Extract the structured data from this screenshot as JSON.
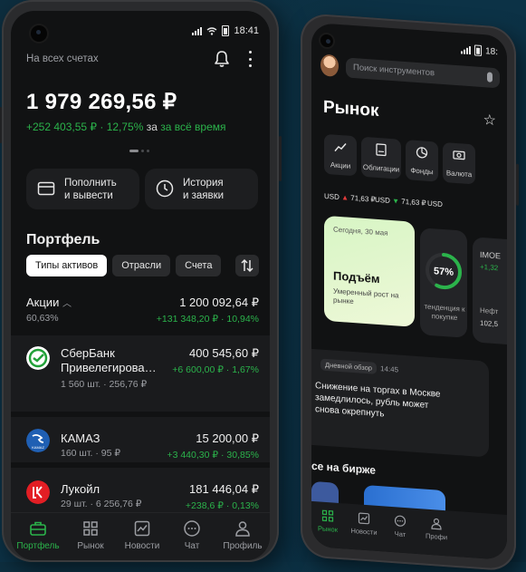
{
  "left": {
    "status": {
      "time": "18:41"
    },
    "header": {
      "label": "На всех счетах"
    },
    "total": "1 979 269,56 ₽",
    "gain": {
      "value": "+252 403,55 ₽ · 12,75%",
      "period_prefix": "за",
      "period": "за всё время"
    },
    "actions": [
      {
        "label": "Пополнить\nи вывести",
        "icon": "wallet-icon"
      },
      {
        "label": "История\nи заявки",
        "icon": "clock-icon"
      }
    ],
    "portfolio": {
      "title": "Портфель",
      "chips": [
        "Типы активов",
        "Отрасли",
        "Счета"
      ],
      "selected_chip": "Типы активов"
    },
    "section": {
      "title": "Акции",
      "share": "60,63%",
      "value": "1 200 092,64 ₽",
      "change": "+131 348,20 ₽ · 10,94%"
    },
    "holdings": [
      {
        "name": "СберБанк",
        "name2": "Привелегирова…",
        "meta": "1 560 шт. · 256,76 ₽",
        "value": "400 545,60 ₽",
        "change": "+6 600,00 ₽ · 1,67%"
      },
      {
        "name": "КАМАЗ",
        "name2": "",
        "meta": "160 шт. · 95 ₽",
        "value": "15 200,00 ₽",
        "change": "+3 440,30 ₽ · 30,85%"
      },
      {
        "name": "Лукойл",
        "name2": "",
        "meta": "29 шт. · 6 256,76 ₽",
        "value": "181 446,04 ₽",
        "change": "+238,6 ₽ · 0,13%"
      }
    ],
    "logo_texts": {
      "kamaz": "KAMAZ"
    },
    "tabs": [
      "Портфель",
      "Рынок",
      "Новости",
      "Чат",
      "Профиль"
    ],
    "active_tab": "Портфель"
  },
  "right": {
    "status": {
      "time": "18:"
    },
    "search_placeholder": "Поиск инструментов",
    "title": "Рынок",
    "categories": [
      "Акции",
      "Облигации",
      "Фонды",
      "Валюта"
    ],
    "tickers": [
      {
        "label": "USD",
        "value": "71,63 ₽",
        "dir": "down"
      },
      {
        "label": "USD",
        "value": "71,63 ₽",
        "dir": "up"
      },
      {
        "label": "USD",
        "value": "",
        "dir": "up"
      }
    ],
    "day_card": {
      "date": "Сегодня, 30 мая",
      "title": "Подъём",
      "subtitle": "Умеренный рост на рынке"
    },
    "gauge": {
      "value": 57,
      "label_value": "57%",
      "caption": "тенденция к покупке"
    },
    "imoex": {
      "name": "IMOE",
      "change": "+1,32",
      "caption": "Нефт",
      "value": "102,5"
    },
    "news": {
      "tag": "Дневной обзор",
      "time": "14:45",
      "text": "Снижение на торгах в Москве замедлилось, рубль может снова окрепнуть"
    },
    "section_title": "се на бирже",
    "tabs": [
      "Рынок",
      "Новости",
      "Чат",
      "Профи"
    ],
    "active_tab": "Рынок"
  },
  "colors": {
    "accent": "#2bb34b",
    "down": "#e23b3b",
    "background": "#0c3246"
  }
}
